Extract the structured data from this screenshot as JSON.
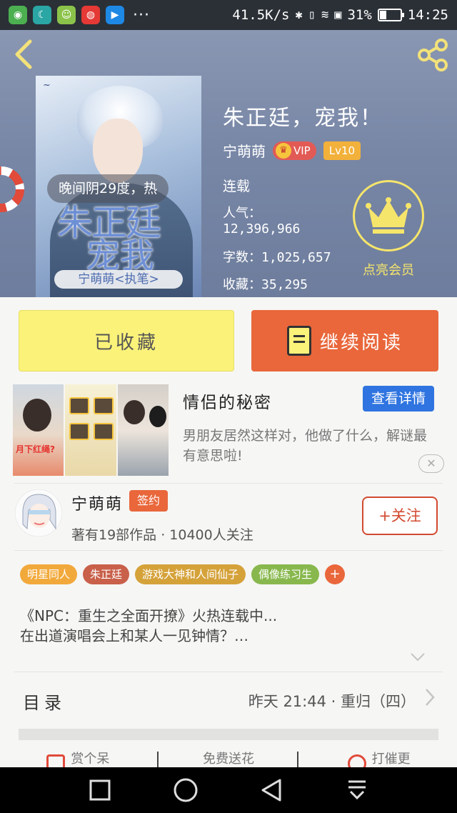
{
  "status_bar": {
    "speed": "41.5K/s",
    "battery": "31%",
    "time": "14:25",
    "more": "···",
    "apps": [
      "app-icon-green",
      "app-icon-moon",
      "app-icon-smile",
      "app-icon-chrome",
      "app-icon-play"
    ]
  },
  "book": {
    "title": "朱正廷，宠我！",
    "author": "宁萌萌",
    "vip_label": "VIP",
    "level": "Lv10",
    "status": "连载",
    "popularity_label": "人气：",
    "popularity_value": "12,396,966",
    "words": "字数：1,025,657",
    "favorites": "收藏：35,295",
    "vip_cta": "点亮会员",
    "cover_weather": "晚间阴29度，热",
    "cover_title_1": "朱正廷",
    "cover_title_2": "宠我",
    "cover_author": "宁萌萌<执笔>"
  },
  "actions": {
    "collected": "已收藏",
    "continue": "继续阅读"
  },
  "ad": {
    "title": "情侣的秘密",
    "detail_button": "查看详情",
    "description": "男朋友居然这样对，他做了什么，解谜最有意思啦!",
    "close": "✕",
    "img_caption": "月下红绳?"
  },
  "author_info": {
    "name": "宁萌萌",
    "badge": "签约",
    "stats": "著有19部作品 · 10400人关注",
    "follow": "+关注"
  },
  "tags": [
    {
      "label": "明星同人",
      "color": "#f2a93b"
    },
    {
      "label": "朱正廷",
      "color": "#c9604a"
    },
    {
      "label": "游戏大神和人间仙子",
      "color": "#d5a23a"
    },
    {
      "label": "偶像练习生",
      "color": "#88b84d"
    }
  ],
  "tag_add": "+",
  "synopsis": {
    "line1": "《NPC：重生之全面开撩》火热连载中...",
    "line2": "在出道演唱会上和某人一见钟情？…"
  },
  "toc": {
    "label": "目录",
    "latest": "昨天 21:44 · 重归（四）"
  },
  "bottom_tabs": [
    "赏个呆",
    "免费送花",
    "打催更"
  ],
  "colors": {
    "accent_orange": "#e9673b",
    "accent_yellow": "#fbf27a",
    "hero_blue": "#7887a6"
  }
}
